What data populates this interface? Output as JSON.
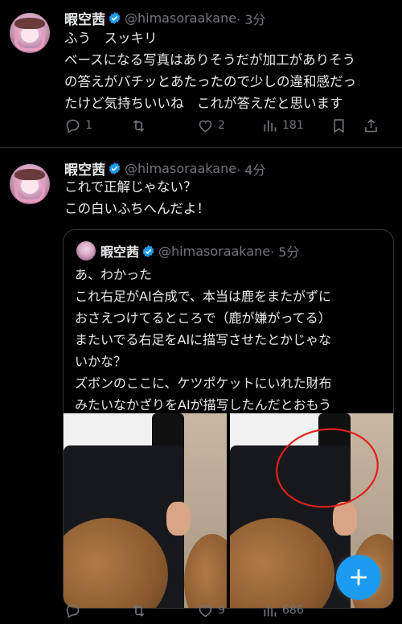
{
  "tweet1": {
    "name": "暇空茜",
    "handle": "@himasoraakane",
    "time": "· 3分",
    "text": "ふう　スッキリ\nベースになる写真はありそうだが加工がありそう\nの答えがバチッとあたったので少しの違和感だっ\nたけど気持ちいいね　これが答えだと思います",
    "replies": "1",
    "retweets": "",
    "likes": "2",
    "views": "181"
  },
  "tweet2": {
    "name": "暇空茜",
    "handle": "@himasoraakane",
    "time": "· 4分",
    "text": "これで正解じゃない？\nこの白いふちへんだよ！",
    "replies": "",
    "retweets": "",
    "likes": "9",
    "views": "686"
  },
  "quote": {
    "name": "暇空茜",
    "handle": "@himasoraakane",
    "time": "· 5分",
    "text": "あ、わかった\nこれ右足がAI合成で、本当は鹿をまたがずに\nおさえつけてるところで（鹿が嫌がってる）\nまたいでる右足をAIに描写させたとかじゃな\nいかな？\nズボンのここに、ケツポケットにいれた財布\nみたいなかざりをAIが描写したんだとおもう"
  },
  "colors": {
    "accent": "#1d9bf0",
    "muted": "#71767b",
    "annotation_circle": "#e0201c"
  },
  "icons": [
    "reply-icon",
    "retweet-icon",
    "like-icon",
    "views-icon",
    "bookmark-icon",
    "share-icon",
    "verified-icon",
    "compose-plus-icon"
  ]
}
